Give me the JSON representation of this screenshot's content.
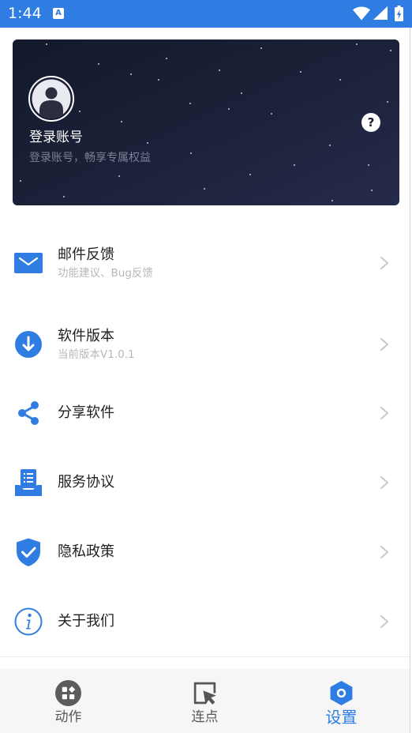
{
  "status_bar": {
    "time": "1:44",
    "notification_icon": "A",
    "icons": [
      "wifi-icon",
      "signal-icon",
      "battery-charging-icon"
    ]
  },
  "account_card": {
    "title": "登录账号",
    "subtitle": "登录账号，畅享专属权益",
    "help_icon": "?"
  },
  "menu": [
    {
      "icon": "mail-icon",
      "title": "邮件反馈",
      "subtitle": "功能建议、Bug反馈"
    },
    {
      "icon": "download-icon",
      "title": "软件版本",
      "subtitle": "当前版本V1.0.1"
    },
    {
      "icon": "share-icon",
      "title": "分享软件"
    },
    {
      "icon": "document-icon",
      "title": "服务协议"
    },
    {
      "icon": "shield-check-icon",
      "title": "隐私政策"
    },
    {
      "icon": "info-icon",
      "title": "关于我们"
    }
  ],
  "bottom_nav": [
    {
      "icon": "actions-icon",
      "label": "动作",
      "active": false
    },
    {
      "icon": "click-cursor-icon",
      "label": "连点",
      "active": false
    },
    {
      "icon": "settings-hexagon-icon",
      "label": "设置",
      "active": true
    }
  ],
  "colors": {
    "primary": "#2f7de3",
    "card_background": "#1a2036",
    "title_text": "#1f1f1f",
    "subtitle_text": "#b7b7b7",
    "nav_inactive": "#575757",
    "nav_background": "#f6f6f6"
  }
}
